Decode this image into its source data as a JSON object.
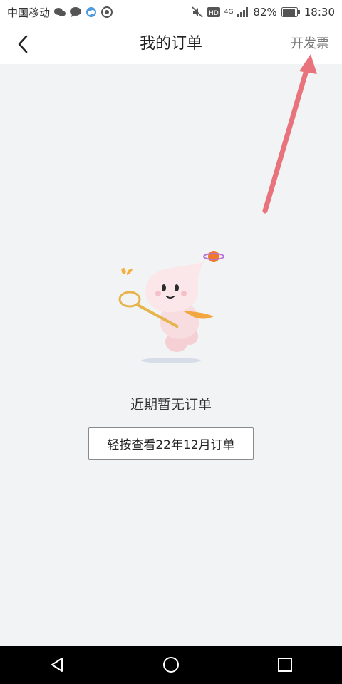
{
  "status_bar": {
    "carrier": "中国移动",
    "network": "4G",
    "battery": "82%",
    "time": "18:30",
    "icons": [
      "wechat-icon",
      "chat-bubble-icon",
      "weather-icon",
      "app-icon",
      "mute-icon",
      "hd-icon",
      "signal-icon",
      "battery-icon"
    ]
  },
  "header": {
    "title": "我的订单",
    "action_label": "开发票"
  },
  "empty_state": {
    "message": "近期暂无订单",
    "button_label": "轻按查看22年12月订单"
  },
  "colors": {
    "background": "#f2f3f5",
    "header_bg": "#ffffff",
    "annotation_arrow": "#e8737c",
    "nav_bar": "#000000"
  },
  "nav_keys": [
    "back-triangle-icon",
    "home-circle-icon",
    "recents-square-icon"
  ]
}
